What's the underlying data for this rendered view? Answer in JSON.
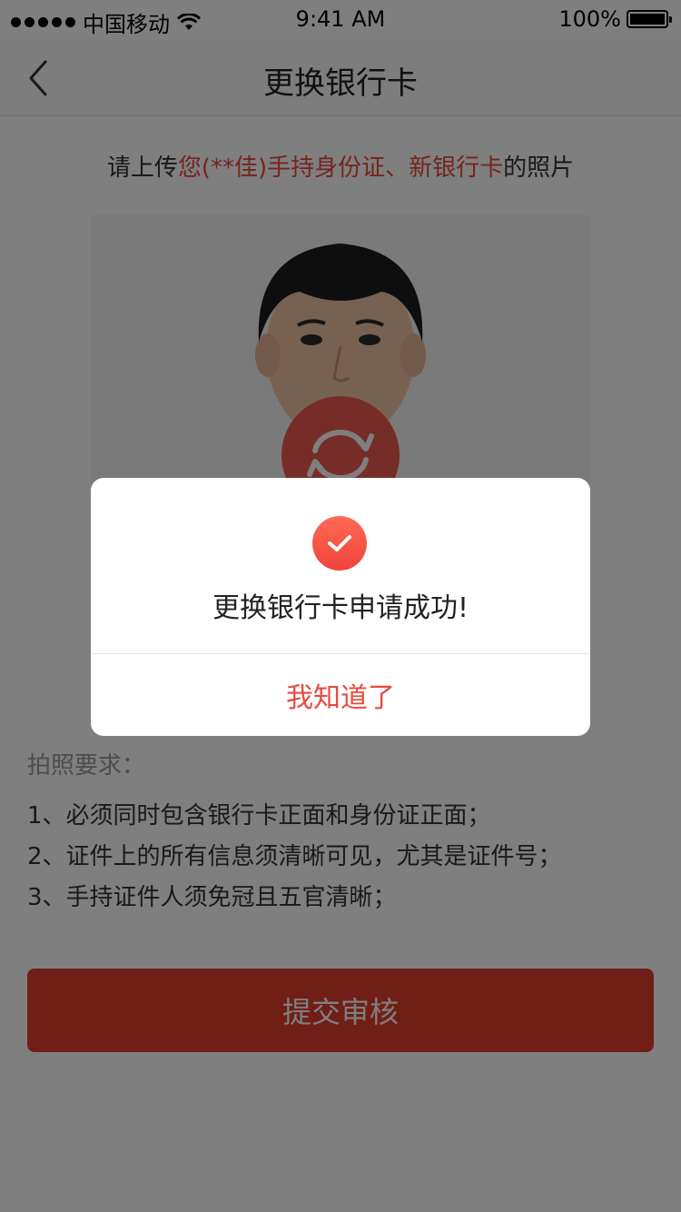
{
  "status_bar": {
    "carrier": "中国移动",
    "time": "9:41 AM",
    "battery": "100%"
  },
  "nav": {
    "title": "更换银行卡",
    "back_icon": "chevron-left-icon"
  },
  "instruction": {
    "prefix": "请上传",
    "highlight_1": "您(**佳)手持身份证、",
    "highlight_2": "新银行卡",
    "suffix": "的照片"
  },
  "photo": {
    "rotate_icon": "rotate-icon"
  },
  "requirements": {
    "title": "拍照要求：",
    "items": [
      "1、必须同时包含银行卡正面和身份证正面；",
      "2、证件上的所有信息须清晰可见，尤其是证件号；",
      "3、手持证件人须免冠且五官清晰；"
    ]
  },
  "submit": {
    "label": "提交审核"
  },
  "dialog": {
    "icon": "check-circle-icon",
    "message": "更换银行卡申请成功!",
    "button": "我知道了"
  },
  "colors": {
    "accent": "#e84a3f",
    "button_bg": "#e23c2f",
    "mask": "rgba(0,0,0,0.5)"
  }
}
